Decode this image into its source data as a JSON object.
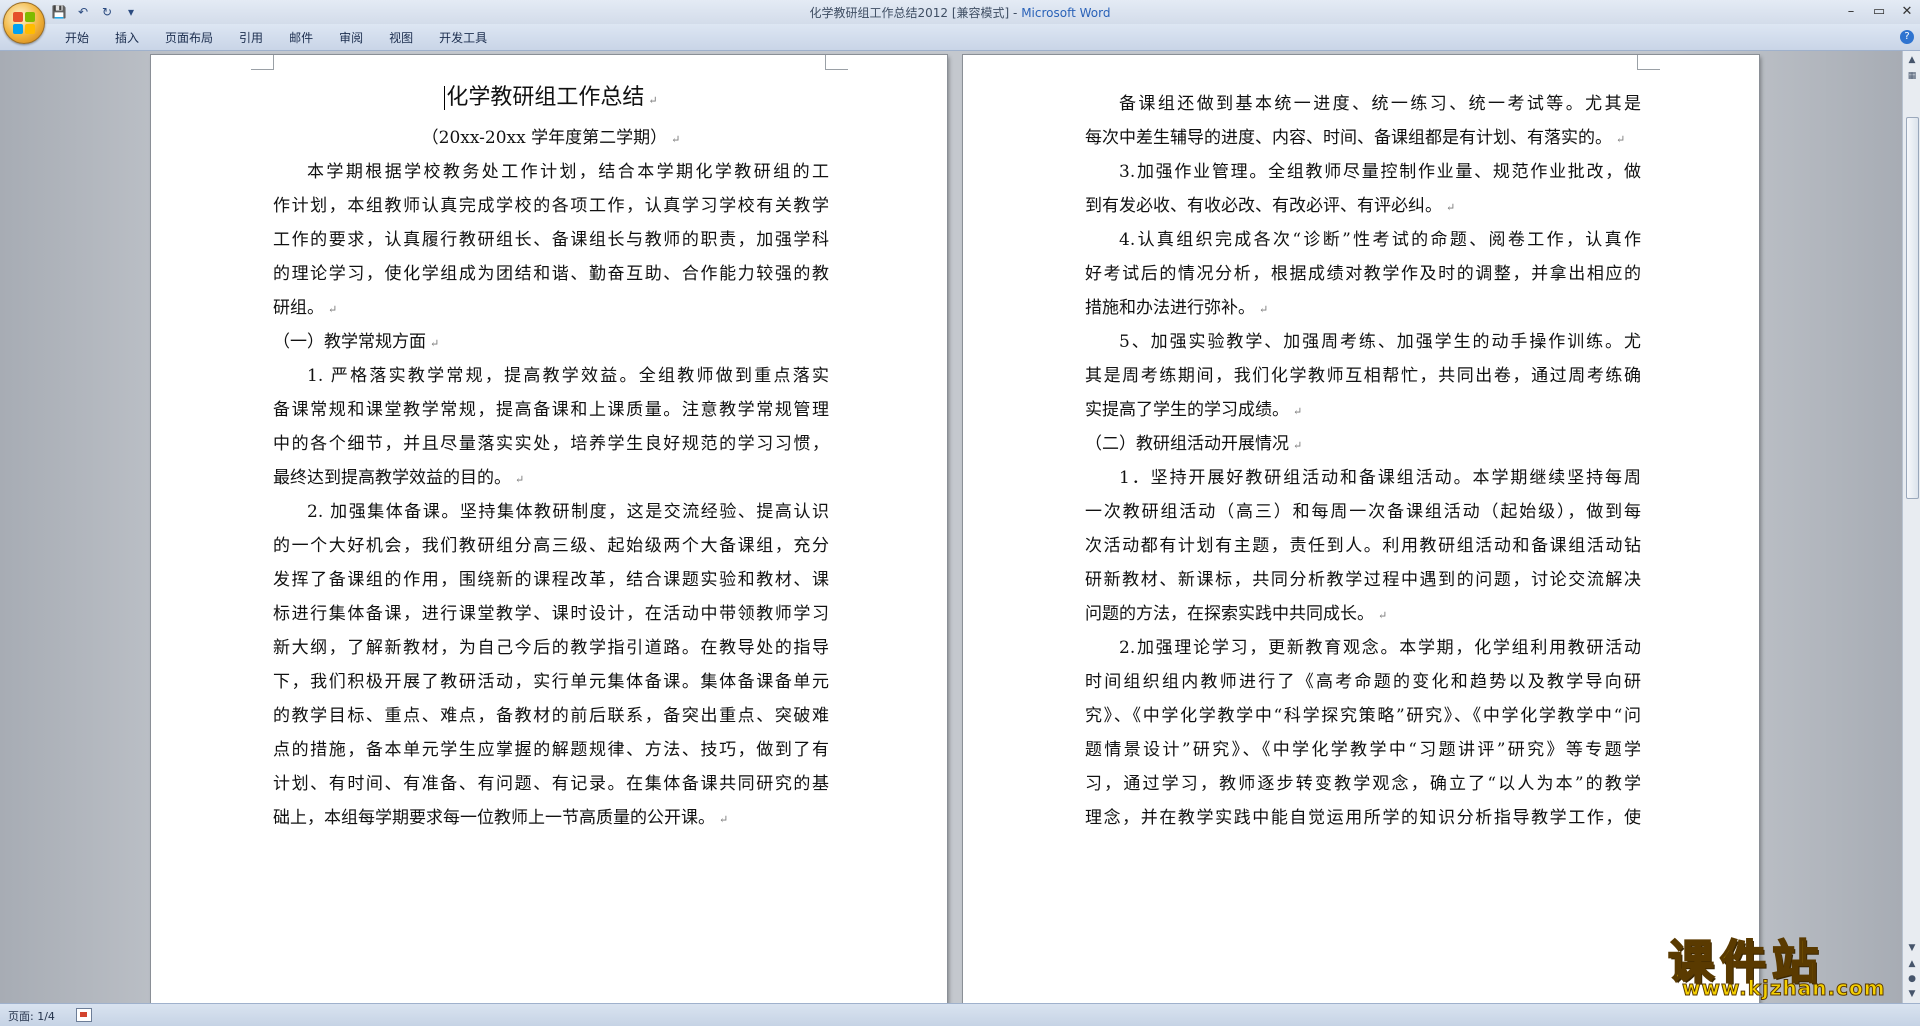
{
  "window": {
    "title": "化学教研组工作总结2012 [兼容模式]",
    "app_name": "Microsoft Word",
    "title_separator": " - "
  },
  "quick_access": [
    "save-icon",
    "undo-icon",
    "redo-icon",
    "customize-icon"
  ],
  "ribbon": {
    "tabs": [
      "开始",
      "插入",
      "页面布局",
      "引用",
      "邮件",
      "审阅",
      "视图",
      "开发工具"
    ]
  },
  "document": {
    "left_page": {
      "title": "化学教研组工作总结",
      "subtitle": "（20xx-20xx 学年度第二学期）",
      "lines": [
        "本学期根据学校教务处工作计划，结合本学期化学教研组的工",
        "作计划，本组教师认真完成学校的各项工作，认真学习学校有关教学",
        "工作的要求，认真履行教研组长、备课组长与教师的职责，加强学科",
        "的理论学习，使化学组成为团结和谐、勤奋互助、合作能力较强的教",
        "研组。",
        "（一）教学常规方面",
        "1. 严格落实教学常规，提高教学效益。全组教师做到重点落实",
        "备课常规和课堂教学常规，提高备课和上课质量。注意教学常规管理",
        "中的各个细节，并且尽量落实实处，培养学生良好规范的学习习惯，",
        "最终达到提高教学效益的目的。",
        "2. 加强集体备课。坚持集体教研制度，这是交流经验、提高认识",
        "的一个大好机会，我们教研组分高三级、起始级两个大备课组，充分",
        "发挥了备课组的作用，围绕新的课程改革，结合课题实验和教材、课",
        "标进行集体备课，进行课堂教学、课时设计，在活动中带领教师学习",
        "新大纲，了解新教材，为自己今后的教学指引道路。在教导处的指导",
        "下，我们积极开展了教研活动，实行单元集体备课。集体备课备单元",
        "的教学目标、重点、难点，备教材的前后联系，备突出重点、突破难",
        "点的措施，备本单元学生应掌握的解题规律、方法、技巧，做到了有",
        "计划、有时间、有准备、有问题、有记录。在集体备课共同研究的基",
        "础上，本组每学期要求每一位教师上一节高质量的公开课。"
      ]
    },
    "right_page": {
      "lines": [
        "备课组还做到基本统一进度、统一练习、统一考试等。尤其是",
        "每次中差生辅导的进度、内容、时间、备课组都是有计划、有落实的。",
        "3.加强作业管理。全组教师尽量控制作业量、规范作业批改，做",
        "到有发必收、有收必改、有改必评、有评必纠。",
        "4.认真组织完成各次“诊断”性考试的命题、阅卷工作，认真作",
        "好考试后的情况分析，根据成绩对教学作及时的调整，并拿出相应的",
        "措施和办法进行弥补。",
        "5、加强实验教学、加强周考练、加强学生的动手操作训练。尤",
        "其是周考练期间，我们化学教师互相帮忙，共同出卷，通过周考练确",
        "实提高了学生的学习成绩。",
        "（二）教研组活动开展情况",
        "1．坚持开展好教研组活动和备课组活动。本学期继续坚持每周",
        "一次教研组活动（高三）和每周一次备课组活动（起始级），做到每",
        "次活动都有计划有主题，责任到人。利用教研组活动和备课组活动钻",
        "研新教材、新课标，共同分析教学过程中遇到的问题，讨论交流解决",
        "问题的方法，在探索实践中共同成长。",
        "2.加强理论学习，更新教育观念。本学期，化学组利用教研活动",
        "时间组织组内教师进行了《高考命题的变化和趋势以及教学导向研",
        "究》、《中学化学教学中“科学探究策略”研究》、《中学化学教学中“问",
        "题情景设计”研究》、《中学化学教学中“习题讲评”研究》等专题学",
        "习，通过学习，教师逐步转变教学观念，确立了“以人为本”的教学",
        "理念，并在教学实践中能自觉运用所学的知识分析指导教学工作，使"
      ]
    },
    "paragraph_mark": "↵"
  },
  "statusbar": {
    "page_indicator": "页面: 1/4"
  },
  "watermark": {
    "main": "课件站",
    "url": "www.kjzhan.com"
  },
  "colors": {
    "app_name": "#2a62b8",
    "watermark": "#f5d000"
  }
}
